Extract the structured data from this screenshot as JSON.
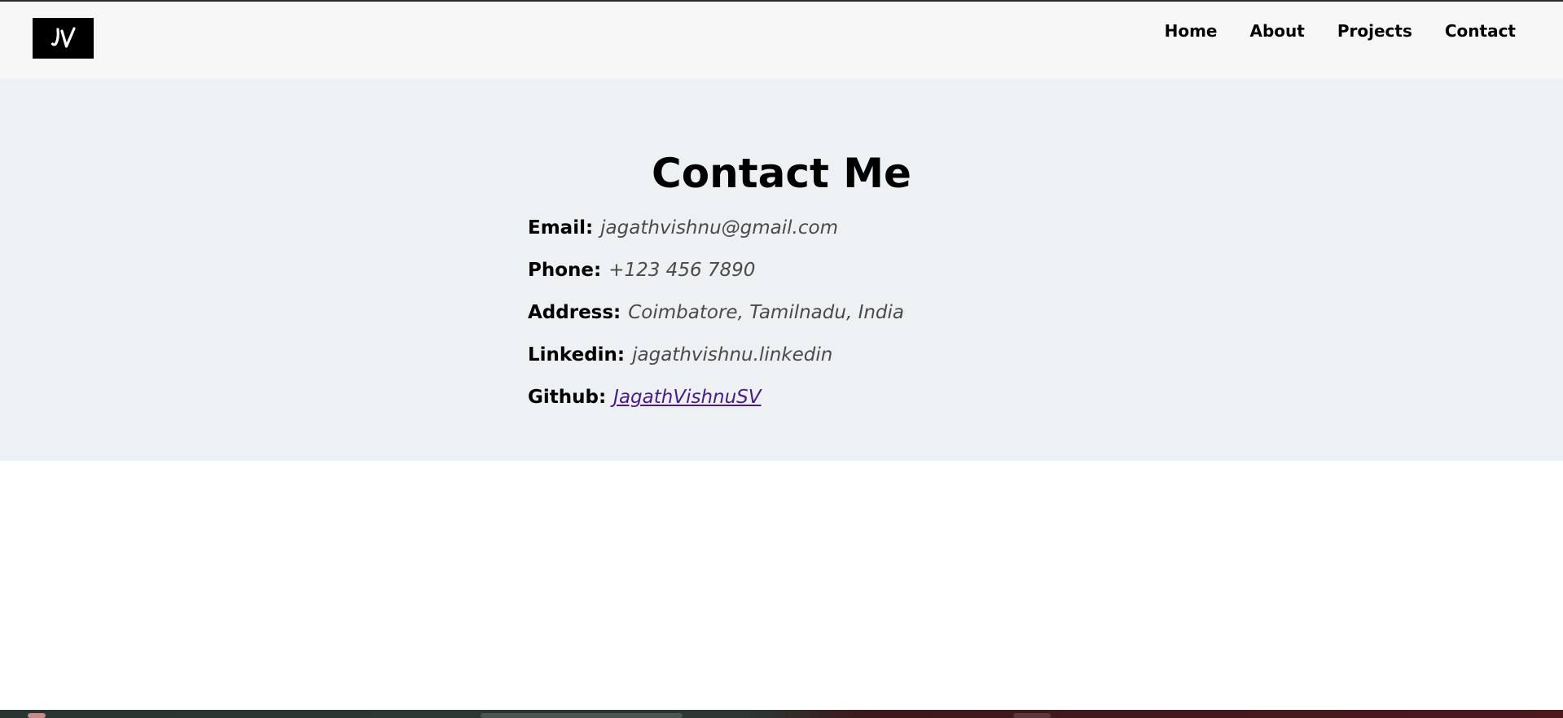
{
  "logo": {
    "text": "JV"
  },
  "nav": {
    "items": [
      "Home",
      "About",
      "Projects",
      "Contact"
    ]
  },
  "contact": {
    "title": "Contact Me",
    "rows": [
      {
        "label": "Email:",
        "value": "jagathvishnu@gmail.com",
        "link": false
      },
      {
        "label": "Phone:",
        "value": "+123 456 7890",
        "link": false
      },
      {
        "label": "Address:",
        "value": "Coimbatore, Tamilnadu, India",
        "link": false
      },
      {
        "label": "Linkedin:",
        "value": "jagathvishnu.linkedin",
        "link": false
      },
      {
        "label": "Github:",
        "value": "JagathVishnuSV",
        "link": true
      }
    ]
  },
  "colors": {
    "header_bg": "#f7f7f7",
    "section_bg": "#eef1f3",
    "value_text": "#4a4a4a",
    "link_visited": "#4b1a8a"
  }
}
